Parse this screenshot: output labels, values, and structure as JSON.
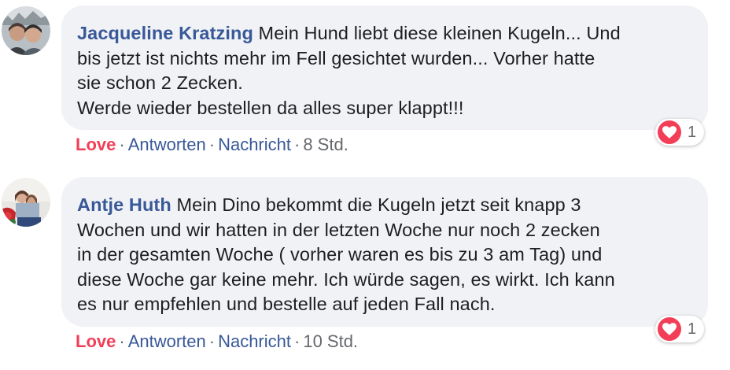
{
  "comments": [
    {
      "author": "Jacqueline Kratzing",
      "text": "Mein Hund liebt diese kleinen Kugeln... Und\nbis jetzt ist nichts mehr im Fell gesichtet wurden... Vorher hatte\nsie schon 2 Zecken.\nWerde wieder bestellen da alles super klappt!!!",
      "actions": {
        "love": "Love",
        "reply": "Antworten",
        "message": "Nachricht",
        "time": "8 Std."
      },
      "reaction_count": "1"
    },
    {
      "author": "Antje Huth",
      "text": "Mein Dino bekommt die Kugeln jetzt seit knapp 3\nWochen und wir hatten in der letzten Woche nur noch 2 zecken\nin der gesamten Woche ( vorher waren es bis zu 3 am Tag) und\ndiese Woche gar keine mehr. Ich würde sagen, es wirkt. Ich kann\nes nur empfehlen und bestelle auf jeden Fall nach.",
      "actions": {
        "love": "Love",
        "reply": "Antworten",
        "message": "Nachricht",
        "time": "10 Std."
      },
      "reaction_count": "1"
    }
  ],
  "separator": "·",
  "colors": {
    "author": "#385898",
    "love": "#f33e58",
    "bubble": "#f0f2f5",
    "meta": "#65676b"
  },
  "icons": {
    "reaction": "heart-icon"
  }
}
